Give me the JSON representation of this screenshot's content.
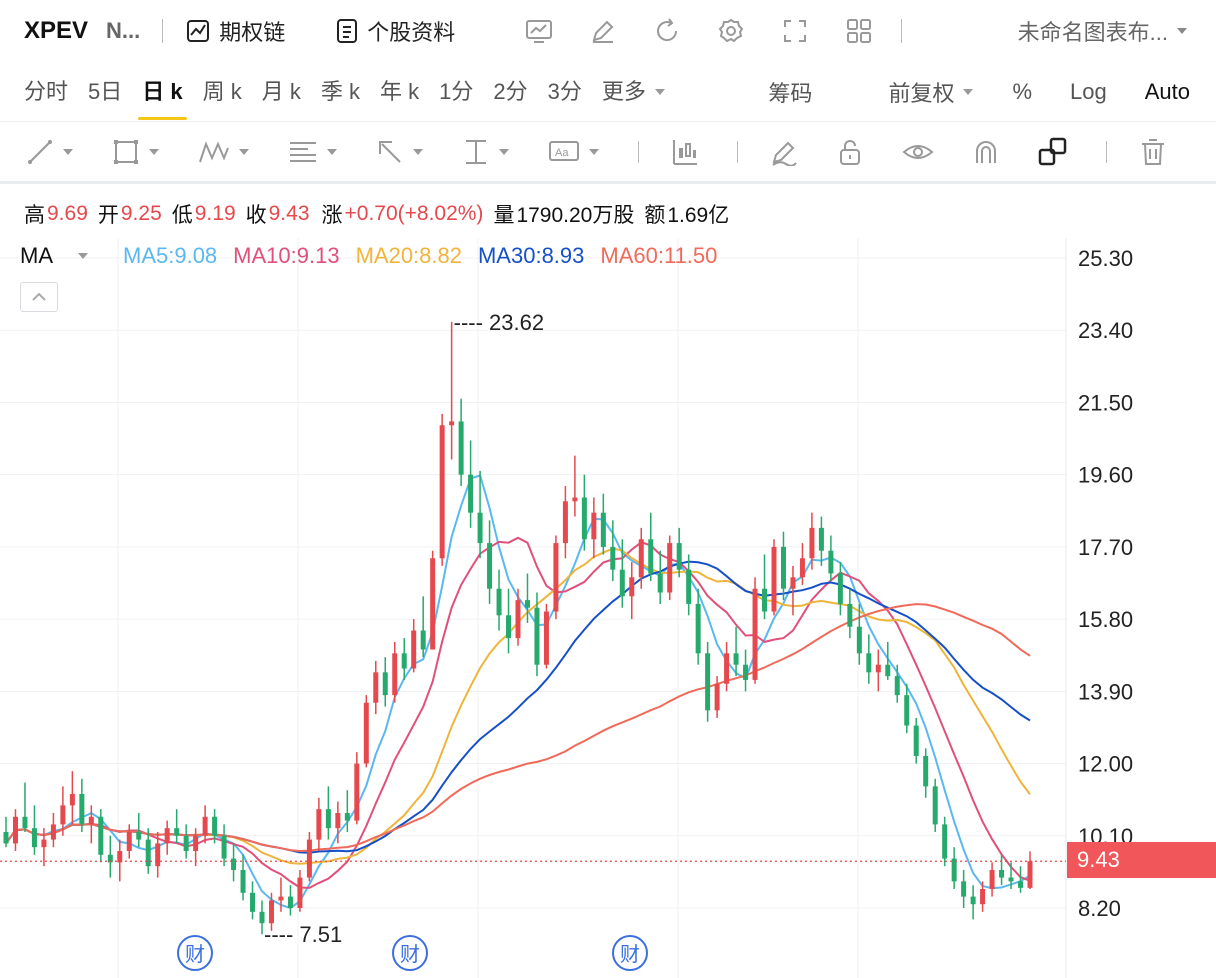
{
  "header": {
    "ticker": "XPEV",
    "short_name": "N...",
    "option_chain": "期权链",
    "stock_profile": "个股资料",
    "layout_name": "未命名图表布...",
    "icons": [
      "chart-template-icon",
      "edit-icon",
      "refresh-icon",
      "gear-icon",
      "fullscreen-icon",
      "grid-layout-icon"
    ]
  },
  "timeframes": [
    {
      "label": "分时",
      "active": false
    },
    {
      "label": "5日",
      "active": false
    },
    {
      "label": "日 k",
      "active": true
    },
    {
      "label": "周 k",
      "active": false
    },
    {
      "label": "月 k",
      "active": false
    },
    {
      "label": "季 k",
      "active": false
    },
    {
      "label": "年 k",
      "active": false
    },
    {
      "label": "1分",
      "active": false
    },
    {
      "label": "2分",
      "active": false
    },
    {
      "label": "3分",
      "active": false
    }
  ],
  "timeframe_more": "更多",
  "options": {
    "chips": "筹码",
    "adjust": "前复权",
    "percent": "%",
    "log": "Log",
    "auto": "Auto"
  },
  "drawing_tools": [
    "trend-line-icon",
    "rectangle-icon",
    "pattern-icon",
    "fib-icon",
    "arrow-icon",
    "measure-icon",
    "text-icon",
    "indicator-icon",
    "brush-icon",
    "lock-icon",
    "eye-icon",
    "magnet-icon",
    "link-icon",
    "trash-icon"
  ],
  "quote": {
    "high_label": "高",
    "high": "9.69",
    "open_label": "开",
    "open": "9.25",
    "low_label": "低",
    "low": "9.19",
    "close_label": "收",
    "close": "9.43",
    "change_label": "涨",
    "change": "+0.70(+8.02%)",
    "volume_label": "量",
    "volume": "1790.20万股",
    "amount_label": "额",
    "amount": "1.69亿",
    "colors": {
      "up": "#e5484d",
      "label": "#111111"
    }
  },
  "ma": {
    "label": "MA",
    "items": [
      {
        "text": "MA5:9.08",
        "color": "#5ab8f0"
      },
      {
        "text": "MA10:9.13",
        "color": "#e0507a"
      },
      {
        "text": "MA20:8.82",
        "color": "#efb43a"
      },
      {
        "text": "MA30:8.93",
        "color": "#1650c8"
      },
      {
        "text": "MA60:11.50",
        "color": "#f06a5a"
      }
    ]
  },
  "chart_data": {
    "type": "candlestick",
    "y_axis_ticks": [
      "25.30",
      "23.40",
      "21.50",
      "19.60",
      "17.70",
      "15.80",
      "13.90",
      "12.00",
      "10.10",
      "8.20"
    ],
    "ylim": [
      8.2,
      25.3
    ],
    "current_price": "9.43",
    "max_label": "23.62",
    "min_label": "7.51",
    "max_value": 23.62,
    "min_value": 7.51,
    "earnings_marker": "财",
    "earnings_marker_positions": [
      0.155,
      0.37,
      0.59
    ],
    "grid": true,
    "colors": {
      "up": "#e5484d",
      "down": "#26a96c",
      "price_line": "#e5484d"
    },
    "candles_approx": [
      [
        10.2,
        10.6,
        9.8,
        9.9
      ],
      [
        9.9,
        10.8,
        9.7,
        10.6
      ],
      [
        10.6,
        11.5,
        10.2,
        10.3
      ],
      [
        10.3,
        10.9,
        9.6,
        9.8
      ],
      [
        9.8,
        10.3,
        9.3,
        10.0
      ],
      [
        10.0,
        10.7,
        9.8,
        10.4
      ],
      [
        10.4,
        11.4,
        10.1,
        10.9
      ],
      [
        10.9,
        11.8,
        10.4,
        11.2
      ],
      [
        11.2,
        11.6,
        10.2,
        10.4
      ],
      [
        10.4,
        10.9,
        9.9,
        10.6
      ],
      [
        10.6,
        10.8,
        9.4,
        9.6
      ],
      [
        9.6,
        10.1,
        9.0,
        9.4
      ],
      [
        9.4,
        10.0,
        8.9,
        9.7
      ],
      [
        9.7,
        10.4,
        9.5,
        10.2
      ],
      [
        10.2,
        10.7,
        9.8,
        10.0
      ],
      [
        10.0,
        10.3,
        9.1,
        9.3
      ],
      [
        9.3,
        10.2,
        9.0,
        9.9
      ],
      [
        9.9,
        10.5,
        9.6,
        10.3
      ],
      [
        10.3,
        10.8,
        9.9,
        10.1
      ],
      [
        10.1,
        10.4,
        9.5,
        9.7
      ],
      [
        9.7,
        10.3,
        9.3,
        10.1
      ],
      [
        10.1,
        10.9,
        9.9,
        10.6
      ],
      [
        10.6,
        10.8,
        9.9,
        10.1
      ],
      [
        10.1,
        10.4,
        9.3,
        9.5
      ],
      [
        9.5,
        9.9,
        8.9,
        9.2
      ],
      [
        9.2,
        9.6,
        8.4,
        8.6
      ],
      [
        8.6,
        8.9,
        7.9,
        8.1
      ],
      [
        8.1,
        8.4,
        7.51,
        7.8
      ],
      [
        7.8,
        8.6,
        7.6,
        8.4
      ],
      [
        8.4,
        9.0,
        8.1,
        8.5
      ],
      [
        8.5,
        8.8,
        8.0,
        8.2
      ],
      [
        8.2,
        9.2,
        8.1,
        9.0
      ],
      [
        9.0,
        10.2,
        8.9,
        10.0
      ],
      [
        10.0,
        11.1,
        9.7,
        10.8
      ],
      [
        10.8,
        11.4,
        10.0,
        10.3
      ],
      [
        10.3,
        11.0,
        9.9,
        10.7
      ],
      [
        10.7,
        11.3,
        10.2,
        10.5
      ],
      [
        10.5,
        12.3,
        10.4,
        12.0
      ],
      [
        12.0,
        13.8,
        11.9,
        13.6
      ],
      [
        13.6,
        14.7,
        13.3,
        14.4
      ],
      [
        14.4,
        14.8,
        13.5,
        13.8
      ],
      [
        13.8,
        15.2,
        13.6,
        14.9
      ],
      [
        14.9,
        15.3,
        14.2,
        14.5
      ],
      [
        14.5,
        15.8,
        14.4,
        15.5
      ],
      [
        15.5,
        16.4,
        14.8,
        15.0
      ],
      [
        15.0,
        17.6,
        15.0,
        17.4
      ],
      [
        17.4,
        21.2,
        17.2,
        20.9
      ],
      [
        20.9,
        23.62,
        20.0,
        21.0
      ],
      [
        21.0,
        21.6,
        19.3,
        19.6
      ],
      [
        19.6,
        20.5,
        18.2,
        18.6
      ],
      [
        18.6,
        19.7,
        17.4,
        17.8
      ],
      [
        17.8,
        18.4,
        16.2,
        16.6
      ],
      [
        16.6,
        17.1,
        15.5,
        15.9
      ],
      [
        15.9,
        16.6,
        14.9,
        15.3
      ],
      [
        15.3,
        16.6,
        15.1,
        16.3
      ],
      [
        16.3,
        17.0,
        15.7,
        16.1
      ],
      [
        16.1,
        16.5,
        14.3,
        14.6
      ],
      [
        14.6,
        16.2,
        14.5,
        16.0
      ],
      [
        16.0,
        18.0,
        15.8,
        17.8
      ],
      [
        17.8,
        19.3,
        17.4,
        18.9
      ],
      [
        18.9,
        20.1,
        18.5,
        19.0
      ],
      [
        19.0,
        19.6,
        17.6,
        17.9
      ],
      [
        17.9,
        19.0,
        17.4,
        18.6
      ],
      [
        18.6,
        19.1,
        17.5,
        17.7
      ],
      [
        17.7,
        18.4,
        16.8,
        17.1
      ],
      [
        17.1,
        17.9,
        16.1,
        16.4
      ],
      [
        16.4,
        17.3,
        15.8,
        16.9
      ],
      [
        16.9,
        18.2,
        16.6,
        17.9
      ],
      [
        17.9,
        18.6,
        16.8,
        17.0
      ],
      [
        17.0,
        17.6,
        16.2,
        16.5
      ],
      [
        16.5,
        18.0,
        16.3,
        17.8
      ],
      [
        17.8,
        18.2,
        16.9,
        17.1
      ],
      [
        17.1,
        17.5,
        15.9,
        16.2
      ],
      [
        16.2,
        16.6,
        14.6,
        14.9
      ],
      [
        14.9,
        15.2,
        13.1,
        13.4
      ],
      [
        13.4,
        14.3,
        13.2,
        14.1
      ],
      [
        14.1,
        15.2,
        13.9,
        14.9
      ],
      [
        14.9,
        15.6,
        14.3,
        14.6
      ],
      [
        14.6,
        15.0,
        13.9,
        14.2
      ],
      [
        14.2,
        16.9,
        14.1,
        16.6
      ],
      [
        16.6,
        17.5,
        15.8,
        16.0
      ],
      [
        16.0,
        17.9,
        15.9,
        17.7
      ],
      [
        17.7,
        18.1,
        16.3,
        16.6
      ],
      [
        16.6,
        17.2,
        15.9,
        16.9
      ],
      [
        16.9,
        17.8,
        16.7,
        17.4
      ],
      [
        17.4,
        18.6,
        17.1,
        18.2
      ],
      [
        18.2,
        18.5,
        17.2,
        17.6
      ],
      [
        17.6,
        18.0,
        16.8,
        17.0
      ],
      [
        17.0,
        17.3,
        15.9,
        16.2
      ],
      [
        16.2,
        16.6,
        15.3,
        15.6
      ],
      [
        15.6,
        16.2,
        14.6,
        14.9
      ],
      [
        14.9,
        15.4,
        14.1,
        14.4
      ],
      [
        14.4,
        15.0,
        13.9,
        14.6
      ],
      [
        14.6,
        15.2,
        14.2,
        14.3
      ],
      [
        14.3,
        14.6,
        13.6,
        13.8
      ],
      [
        13.8,
        14.1,
        12.8,
        13.0
      ],
      [
        13.0,
        13.2,
        12.0,
        12.2
      ],
      [
        12.2,
        12.4,
        11.1,
        11.4
      ],
      [
        11.4,
        11.6,
        10.2,
        10.4
      ],
      [
        10.4,
        10.6,
        9.3,
        9.5
      ],
      [
        9.5,
        9.8,
        8.7,
        8.9
      ],
      [
        8.9,
        9.2,
        8.2,
        8.5
      ],
      [
        8.5,
        8.8,
        7.9,
        8.3
      ],
      [
        8.3,
        8.9,
        8.1,
        8.7
      ],
      [
        8.7,
        9.4,
        8.5,
        9.2
      ],
      [
        9.2,
        9.6,
        8.8,
        9.0
      ],
      [
        9.0,
        9.4,
        8.7,
        8.9
      ],
      [
        8.9,
        9.3,
        8.6,
        8.73
      ],
      [
        8.73,
        9.69,
        8.7,
        9.43
      ]
    ]
  }
}
